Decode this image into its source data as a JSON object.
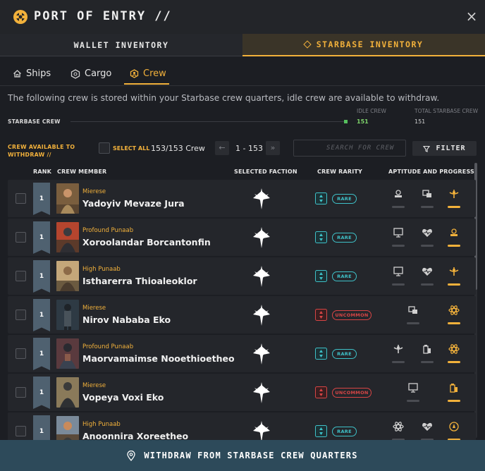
{
  "window": {
    "title": "PORT OF ENTRY //",
    "close_label": "×"
  },
  "tabs": [
    {
      "label": "WALLET INVENTORY",
      "active": false
    },
    {
      "label": "STARBASE INVENTORY",
      "active": true
    }
  ],
  "subtabs": [
    {
      "label": "Ships",
      "icon": "home-icon"
    },
    {
      "label": "Cargo",
      "icon": "cargo-icon"
    },
    {
      "label": "Crew",
      "icon": "crew-icon",
      "active": true
    }
  ],
  "description": "The following crew is stored within your Starbase crew quarters, idle crew are available to withdraw.",
  "starbase": {
    "label": "STARBASE CREW",
    "idle_label": "IDLE CREW",
    "idle_value": "151",
    "total_label": "TOTAL STARBASE CREW",
    "total_value": "151"
  },
  "toolbar": {
    "available_label": "CREW AVAILABLE TO WITHDRAW //",
    "select_all_label": "SELECT ALL",
    "crew_count": "153/153 Crew",
    "prev_label": "←",
    "next_label": "»",
    "page_range": "1 - 153",
    "search_placeholder": "SEARCH FOR CREW",
    "filter_label": "FILTER"
  },
  "table": {
    "headers": {
      "rank": "RANK",
      "member": "CREW MEMBER",
      "faction": "SELECTED FACTION",
      "rarity": "CREW RARITY",
      "aptitude": "APTITUDE AND PROGRESS"
    },
    "rows": [
      {
        "rank": "1",
        "faction": "Mierese",
        "name": "Yadoyiv Mevaze Jura",
        "rarity": "RARE",
        "rarity_class": "rare"
      },
      {
        "rank": "1",
        "faction": "Profound Punaab",
        "name": "Xoroolandar Borcantonfin",
        "rarity": "RARE",
        "rarity_class": "rare"
      },
      {
        "rank": "1",
        "faction": "High Punaab",
        "name": "Istharerra Thioaleoklor",
        "rarity": "RARE",
        "rarity_class": "rare"
      },
      {
        "rank": "1",
        "faction": "Mierese",
        "name": "Nirov Nababa Eko",
        "rarity": "UNCOMMON",
        "rarity_class": "uncommon"
      },
      {
        "rank": "1",
        "faction": "Profound Punaab",
        "name": "Maorvamaimse Nooethioetheo",
        "rarity": "RARE",
        "rarity_class": "rare"
      },
      {
        "rank": "1",
        "faction": "Mierese",
        "name": "Vopeya Voxi Eko",
        "rarity": "UNCOMMON",
        "rarity_class": "uncommon"
      },
      {
        "rank": "1",
        "faction": "High Punaab",
        "name": "Anoonnira Xoreetheo",
        "rarity": "RARE",
        "rarity_class": "rare"
      }
    ]
  },
  "footer": {
    "label": "WITHDRAW FROM STARBASE CREW QUARTERS"
  },
  "colors": {
    "accent": "#f2b13b",
    "rare": "#3ec1c8",
    "uncommon": "#d84545",
    "idle": "#7ed36b",
    "footer_bg": "#2d4a5a"
  }
}
